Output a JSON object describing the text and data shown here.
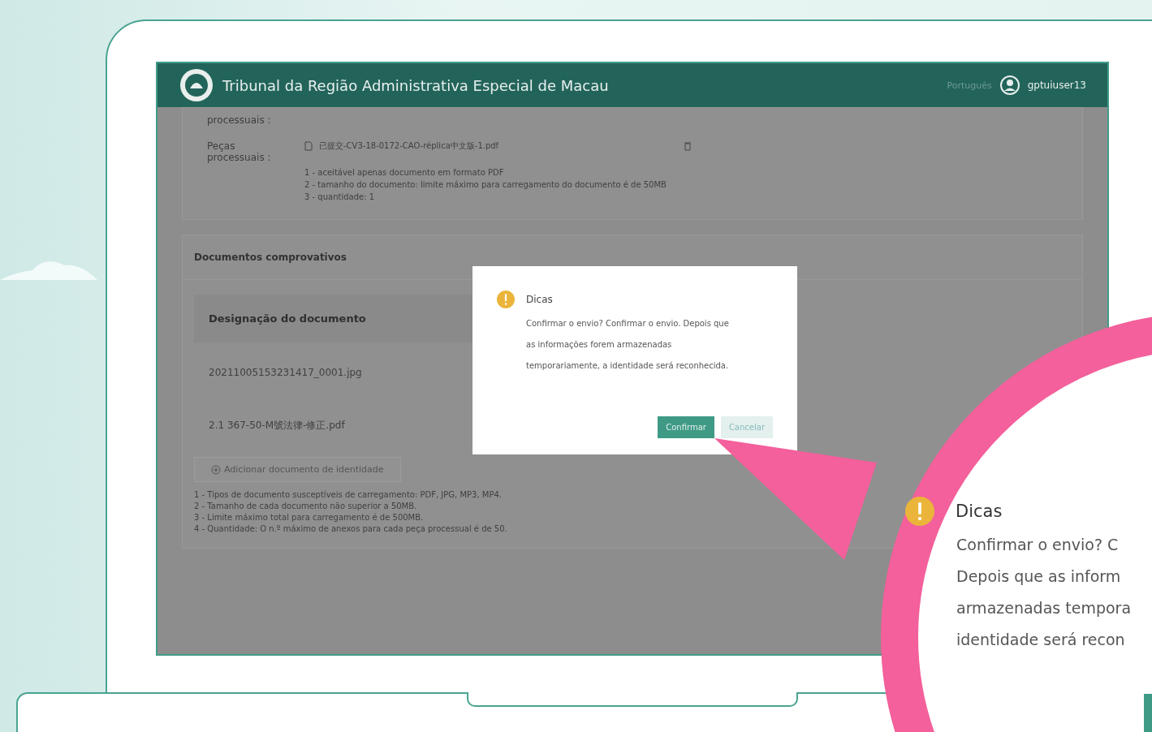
{
  "header": {
    "title": "Tribunal da Região Administrativa Especial de Macau",
    "language": "Português",
    "user": "gptuiuser13"
  },
  "pecas": {
    "top_label": "processuais :",
    "label": "Peças processuais :",
    "file": "已提交-CV3-18-0172-CAO-réplica中文版-1.pdf",
    "notes": [
      "1 - aceitável apenas documento em formato PDF",
      "2 - tamanho do documento: limite máximo para carregamento do documento é de 50MB",
      "3 - quantidade: 1"
    ]
  },
  "documentos": {
    "title": "Documentos comprovativos",
    "column": "Designação do documento",
    "rows": [
      "20211005153231417_0001.jpg",
      "2.1 367-50-M號法律-修正.pdf"
    ],
    "add_button": "Adicionar documento de identidade",
    "notes": [
      "1 - Tipos de documento susceptíveis de carregamento: PDF, JPG, MP3, MP4.",
      "2 - Tamanho de cada documento não superior a 50MB.",
      "3 - Limite máximo total para carregamento é de 500MB.",
      "4 - Quantidade: O n.º máximo de anexos para cada peça processual é de 50."
    ]
  },
  "dialog": {
    "title": "Dicas",
    "message": "Confirmar o envio? Confirmar o envio. Depois que as informações forem armazenadas temporariamente, a identidade será reconhecida.",
    "confirm": "Confirmar",
    "cancel": "Cancelar"
  },
  "callout": {
    "title": "Dicas",
    "lines": [
      "Confirmar o envio? C",
      "Depois que as inform",
      "armazenadas tempora",
      "identidade será recon"
    ]
  }
}
